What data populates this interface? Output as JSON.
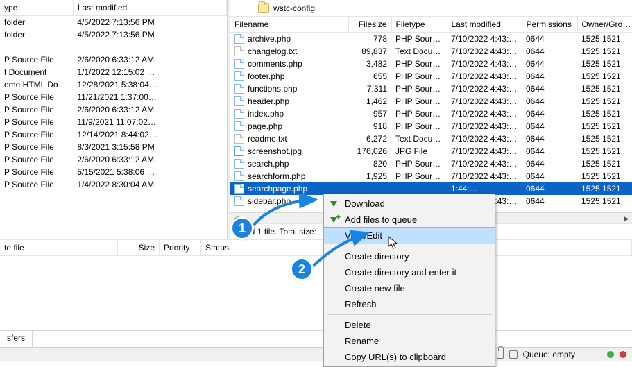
{
  "tree_label": "wstc-config",
  "left": {
    "headers": {
      "type": "ype",
      "modified": "Last modified"
    },
    "rows": [
      {
        "type": "folder",
        "modified": "4/5/2022 7:13:56 PM"
      },
      {
        "type": "folder",
        "modified": "4/5/2022 7:13:56 PM"
      },
      {
        "type": "",
        "modified": ""
      },
      {
        "type": "P Source File",
        "modified": "2/6/2020 6:33:12 AM"
      },
      {
        "type": "t Document",
        "modified": "1/1/2022 12:15:02 …"
      },
      {
        "type": "ome HTML Do…",
        "modified": "12/28/2021 5:38:04…"
      },
      {
        "type": "P Source File",
        "modified": "11/21/2021 1:37:00…"
      },
      {
        "type": "P Source File",
        "modified": "2/6/2020 6:33:12 AM"
      },
      {
        "type": "P Source File",
        "modified": "11/9/2021 11:07:02…"
      },
      {
        "type": "P Source File",
        "modified": "12/14/2021 8:44:02…"
      },
      {
        "type": "P Source File",
        "modified": "8/3/2021 3:15:58 PM"
      },
      {
        "type": "P Source File",
        "modified": "2/6/2020 6:33:12 AM"
      },
      {
        "type": "P Source File",
        "modified": "5/15/2021 5:38:06 …"
      },
      {
        "type": "P Source File",
        "modified": "1/4/2022 8:30:04 AM"
      }
    ]
  },
  "right": {
    "headers": {
      "name": "Filename",
      "size": "Filesize",
      "type": "Filetype",
      "modified": "Last modified",
      "perm": "Permissions",
      "owner": "Owner/Group"
    },
    "rows": [
      {
        "icon": "php",
        "name": "archive.php",
        "size": "778",
        "type": "PHP Sourc…",
        "modified": "7/10/2022 4:43:…",
        "perm": "0644",
        "owner": "1525 1521"
      },
      {
        "icon": "txt",
        "name": "changelog.txt",
        "size": "89,837",
        "type": "Text Docu…",
        "modified": "7/10/2022 4:43:…",
        "perm": "0644",
        "owner": "1525 1521"
      },
      {
        "icon": "php",
        "name": "comments.php",
        "size": "3,482",
        "type": "PHP Sourc…",
        "modified": "7/10/2022 4:43:…",
        "perm": "0644",
        "owner": "1525 1521"
      },
      {
        "icon": "php",
        "name": "footer.php",
        "size": "655",
        "type": "PHP Sourc…",
        "modified": "7/10/2022 4:43:…",
        "perm": "0644",
        "owner": "1525 1521"
      },
      {
        "icon": "php",
        "name": "functions.php",
        "size": "7,311",
        "type": "PHP Sourc…",
        "modified": "7/10/2022 4:43:…",
        "perm": "0644",
        "owner": "1525 1521"
      },
      {
        "icon": "php",
        "name": "header.php",
        "size": "1,462",
        "type": "PHP Sourc…",
        "modified": "7/10/2022 4:43:…",
        "perm": "0644",
        "owner": "1525 1521"
      },
      {
        "icon": "php",
        "name": "index.php",
        "size": "957",
        "type": "PHP Sourc…",
        "modified": "7/10/2022 4:43:…",
        "perm": "0644",
        "owner": "1525 1521"
      },
      {
        "icon": "php",
        "name": "page.php",
        "size": "918",
        "type": "PHP Sourc…",
        "modified": "7/10/2022 4:43:…",
        "perm": "0644",
        "owner": "1525 1521"
      },
      {
        "icon": "txt",
        "name": "readme.txt",
        "size": "6,272",
        "type": "Text Docu…",
        "modified": "7/10/2022 4:43:…",
        "perm": "0644",
        "owner": "1525 1521"
      },
      {
        "icon": "jpg",
        "name": "screenshot.jpg",
        "size": "176,026",
        "type": "JPG File",
        "modified": "7/10/2022 4:43:…",
        "perm": "0644",
        "owner": "1525 1521"
      },
      {
        "icon": "php",
        "name": "search.php",
        "size": "820",
        "type": "PHP Sourc…",
        "modified": "7/10/2022 4:43:…",
        "perm": "0644",
        "owner": "1525 1521"
      },
      {
        "icon": "php",
        "name": "searchform.php",
        "size": "1,925",
        "type": "PHP Sourc…",
        "modified": "7/10/2022 4:43:…",
        "perm": "0644",
        "owner": "1525 1521"
      },
      {
        "icon": "php",
        "name": "searchpage.php",
        "size": "",
        "type": "",
        "modified": "1:44:…",
        "perm": "0644",
        "owner": "1525 1521",
        "selected": true
      },
      {
        "icon": "php",
        "name": "sidebar.php",
        "size": "",
        "type": "",
        "modified": "7/10/2022 4:43:…",
        "perm": "0644",
        "owner": "1525 1521"
      }
    ],
    "status": "ected 1 file. Total size:"
  },
  "ctx": {
    "download": "Download",
    "queue": "Add files to queue",
    "view": "View/Edit",
    "mkdir": "Create directory",
    "mkdir_enter": "Create directory and enter it",
    "newfile": "Create new file",
    "refresh": "Refresh",
    "delete": "Delete",
    "rename": "Rename",
    "copyurl": "Copy URL(s) to clipboard"
  },
  "transfer": {
    "file": "te file",
    "size": "Size",
    "priority": "Priority",
    "status": "Status"
  },
  "tabs": {
    "transfers": "sfers"
  },
  "status": {
    "queue": "Queue: empty"
  },
  "bubbles": {
    "one": "1",
    "two": "2"
  }
}
